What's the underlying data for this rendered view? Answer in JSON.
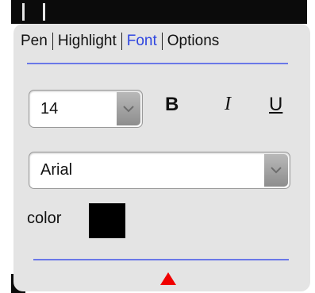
{
  "tabs": [
    {
      "label": "Pen"
    },
    {
      "label": "Highlight"
    },
    {
      "label": "Font",
      "active": true
    },
    {
      "label": "Options"
    }
  ],
  "font_size": {
    "value": "14"
  },
  "format": {
    "bold": "B",
    "italic": "I",
    "underline": "U"
  },
  "font_family": {
    "value": "Arial"
  },
  "color": {
    "label": "color",
    "swatch": "#000000"
  },
  "colors": {
    "accent": "#2f46e0",
    "divider": "#6a78e8",
    "marker": "#f00000",
    "panel": "#e4e4e4"
  },
  "icons": [
    "chevron-down-icon",
    "expand-triangle-icon"
  ]
}
